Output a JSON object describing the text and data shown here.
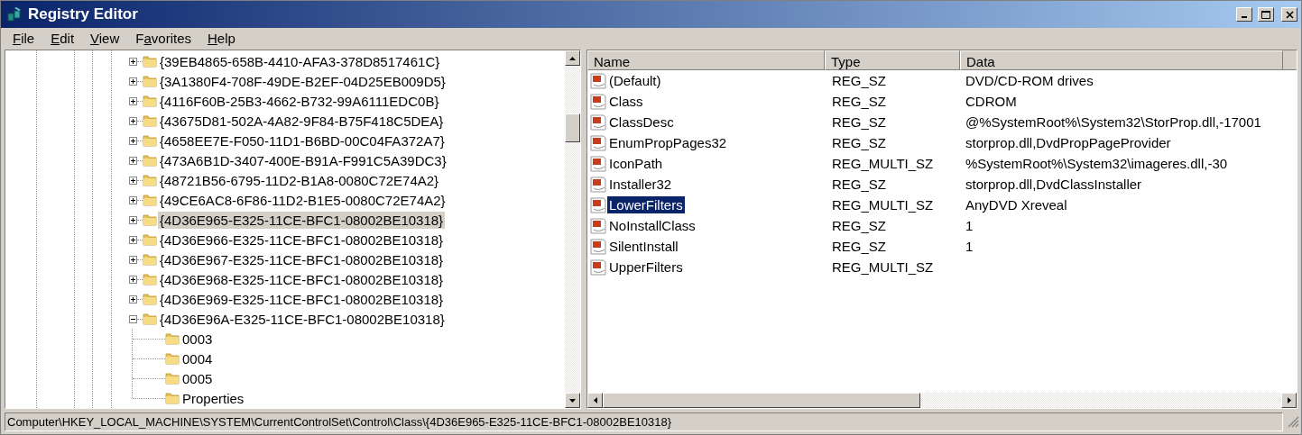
{
  "window": {
    "title": "Registry Editor"
  },
  "menu": [
    {
      "access_key": "F",
      "suffix": "ile"
    },
    {
      "access_key": "E",
      "suffix": "dit"
    },
    {
      "access_key": "V",
      "suffix": "iew"
    },
    {
      "prefix": "F",
      "access_key": "a",
      "suffix": "vorites"
    },
    {
      "access_key": "H",
      "suffix": "elp"
    }
  ],
  "tree": [
    {
      "label": "{39EB4865-658B-4410-AFA3-378D8517461C}",
      "expanded": false,
      "selected": false
    },
    {
      "label": "{3A1380F4-708F-49DE-B2EF-04D25EB009D5}",
      "expanded": false,
      "selected": false
    },
    {
      "label": "{4116F60B-25B3-4662-B732-99A6111EDC0B}",
      "expanded": false,
      "selected": false
    },
    {
      "label": "{43675D81-502A-4A82-9F84-B75F418C5DEA}",
      "expanded": false,
      "selected": false
    },
    {
      "label": "{4658EE7E-F050-11D1-B6BD-00C04FA372A7}",
      "expanded": false,
      "selected": false
    },
    {
      "label": "{473A6B1D-3407-400E-B91A-F991C5A39DC3}",
      "expanded": false,
      "selected": false
    },
    {
      "label": "{48721B56-6795-11D2-B1A8-0080C72E74A2}",
      "expanded": false,
      "selected": false
    },
    {
      "label": "{49CE6AC8-6F86-11D2-B1E5-0080C72E74A2}",
      "expanded": false,
      "selected": false
    },
    {
      "label": "{4D36E965-E325-11CE-BFC1-08002BE10318}",
      "expanded": false,
      "selected": true
    },
    {
      "label": "{4D36E966-E325-11CE-BFC1-08002BE10318}",
      "expanded": false,
      "selected": false
    },
    {
      "label": "{4D36E967-E325-11CE-BFC1-08002BE10318}",
      "expanded": false,
      "selected": false
    },
    {
      "label": "{4D36E968-E325-11CE-BFC1-08002BE10318}",
      "expanded": false,
      "selected": false
    },
    {
      "label": "{4D36E969-E325-11CE-BFC1-08002BE10318}",
      "expanded": false,
      "selected": false
    },
    {
      "label": "{4D36E96A-E325-11CE-BFC1-08002BE10318}",
      "expanded": true,
      "selected": false,
      "children": [
        {
          "label": "0003",
          "selected": false
        },
        {
          "label": "0004",
          "selected": false
        },
        {
          "label": "0005",
          "selected": false
        },
        {
          "label": "Properties",
          "selected": false
        }
      ]
    }
  ],
  "values": {
    "columns": [
      "Name",
      "Type",
      "Data"
    ],
    "rows": [
      {
        "name": "(Default)",
        "type": "REG_SZ",
        "data": "DVD/CD-ROM drives",
        "selected": false
      },
      {
        "name": "Class",
        "type": "REG_SZ",
        "data": "CDROM",
        "selected": false
      },
      {
        "name": "ClassDesc",
        "type": "REG_SZ",
        "data": "@%SystemRoot%\\System32\\StorProp.dll,-17001",
        "selected": false
      },
      {
        "name": "EnumPropPages32",
        "type": "REG_SZ",
        "data": "storprop.dll,DvdPropPageProvider",
        "selected": false
      },
      {
        "name": "IconPath",
        "type": "REG_MULTI_SZ",
        "data": "%SystemRoot%\\System32\\imageres.dll,-30",
        "selected": false
      },
      {
        "name": "Installer32",
        "type": "REG_SZ",
        "data": "storprop.dll,DvdClassInstaller",
        "selected": false
      },
      {
        "name": "LowerFilters",
        "type": "REG_MULTI_SZ",
        "data": "AnyDVD Xreveal",
        "selected": true
      },
      {
        "name": "NoInstallClass",
        "type": "REG_SZ",
        "data": "1",
        "selected": false
      },
      {
        "name": "SilentInstall",
        "type": "REG_SZ",
        "data": "1",
        "selected": false
      },
      {
        "name": "UpperFilters",
        "type": "REG_MULTI_SZ",
        "selected": false
      }
    ]
  },
  "status_bar": "Computer\\HKEY_LOCAL_MACHINE\\SYSTEM\\CurrentControlSet\\Control\\Class\\{4D36E965-E325-11CE-BFC1-08002BE10318}"
}
